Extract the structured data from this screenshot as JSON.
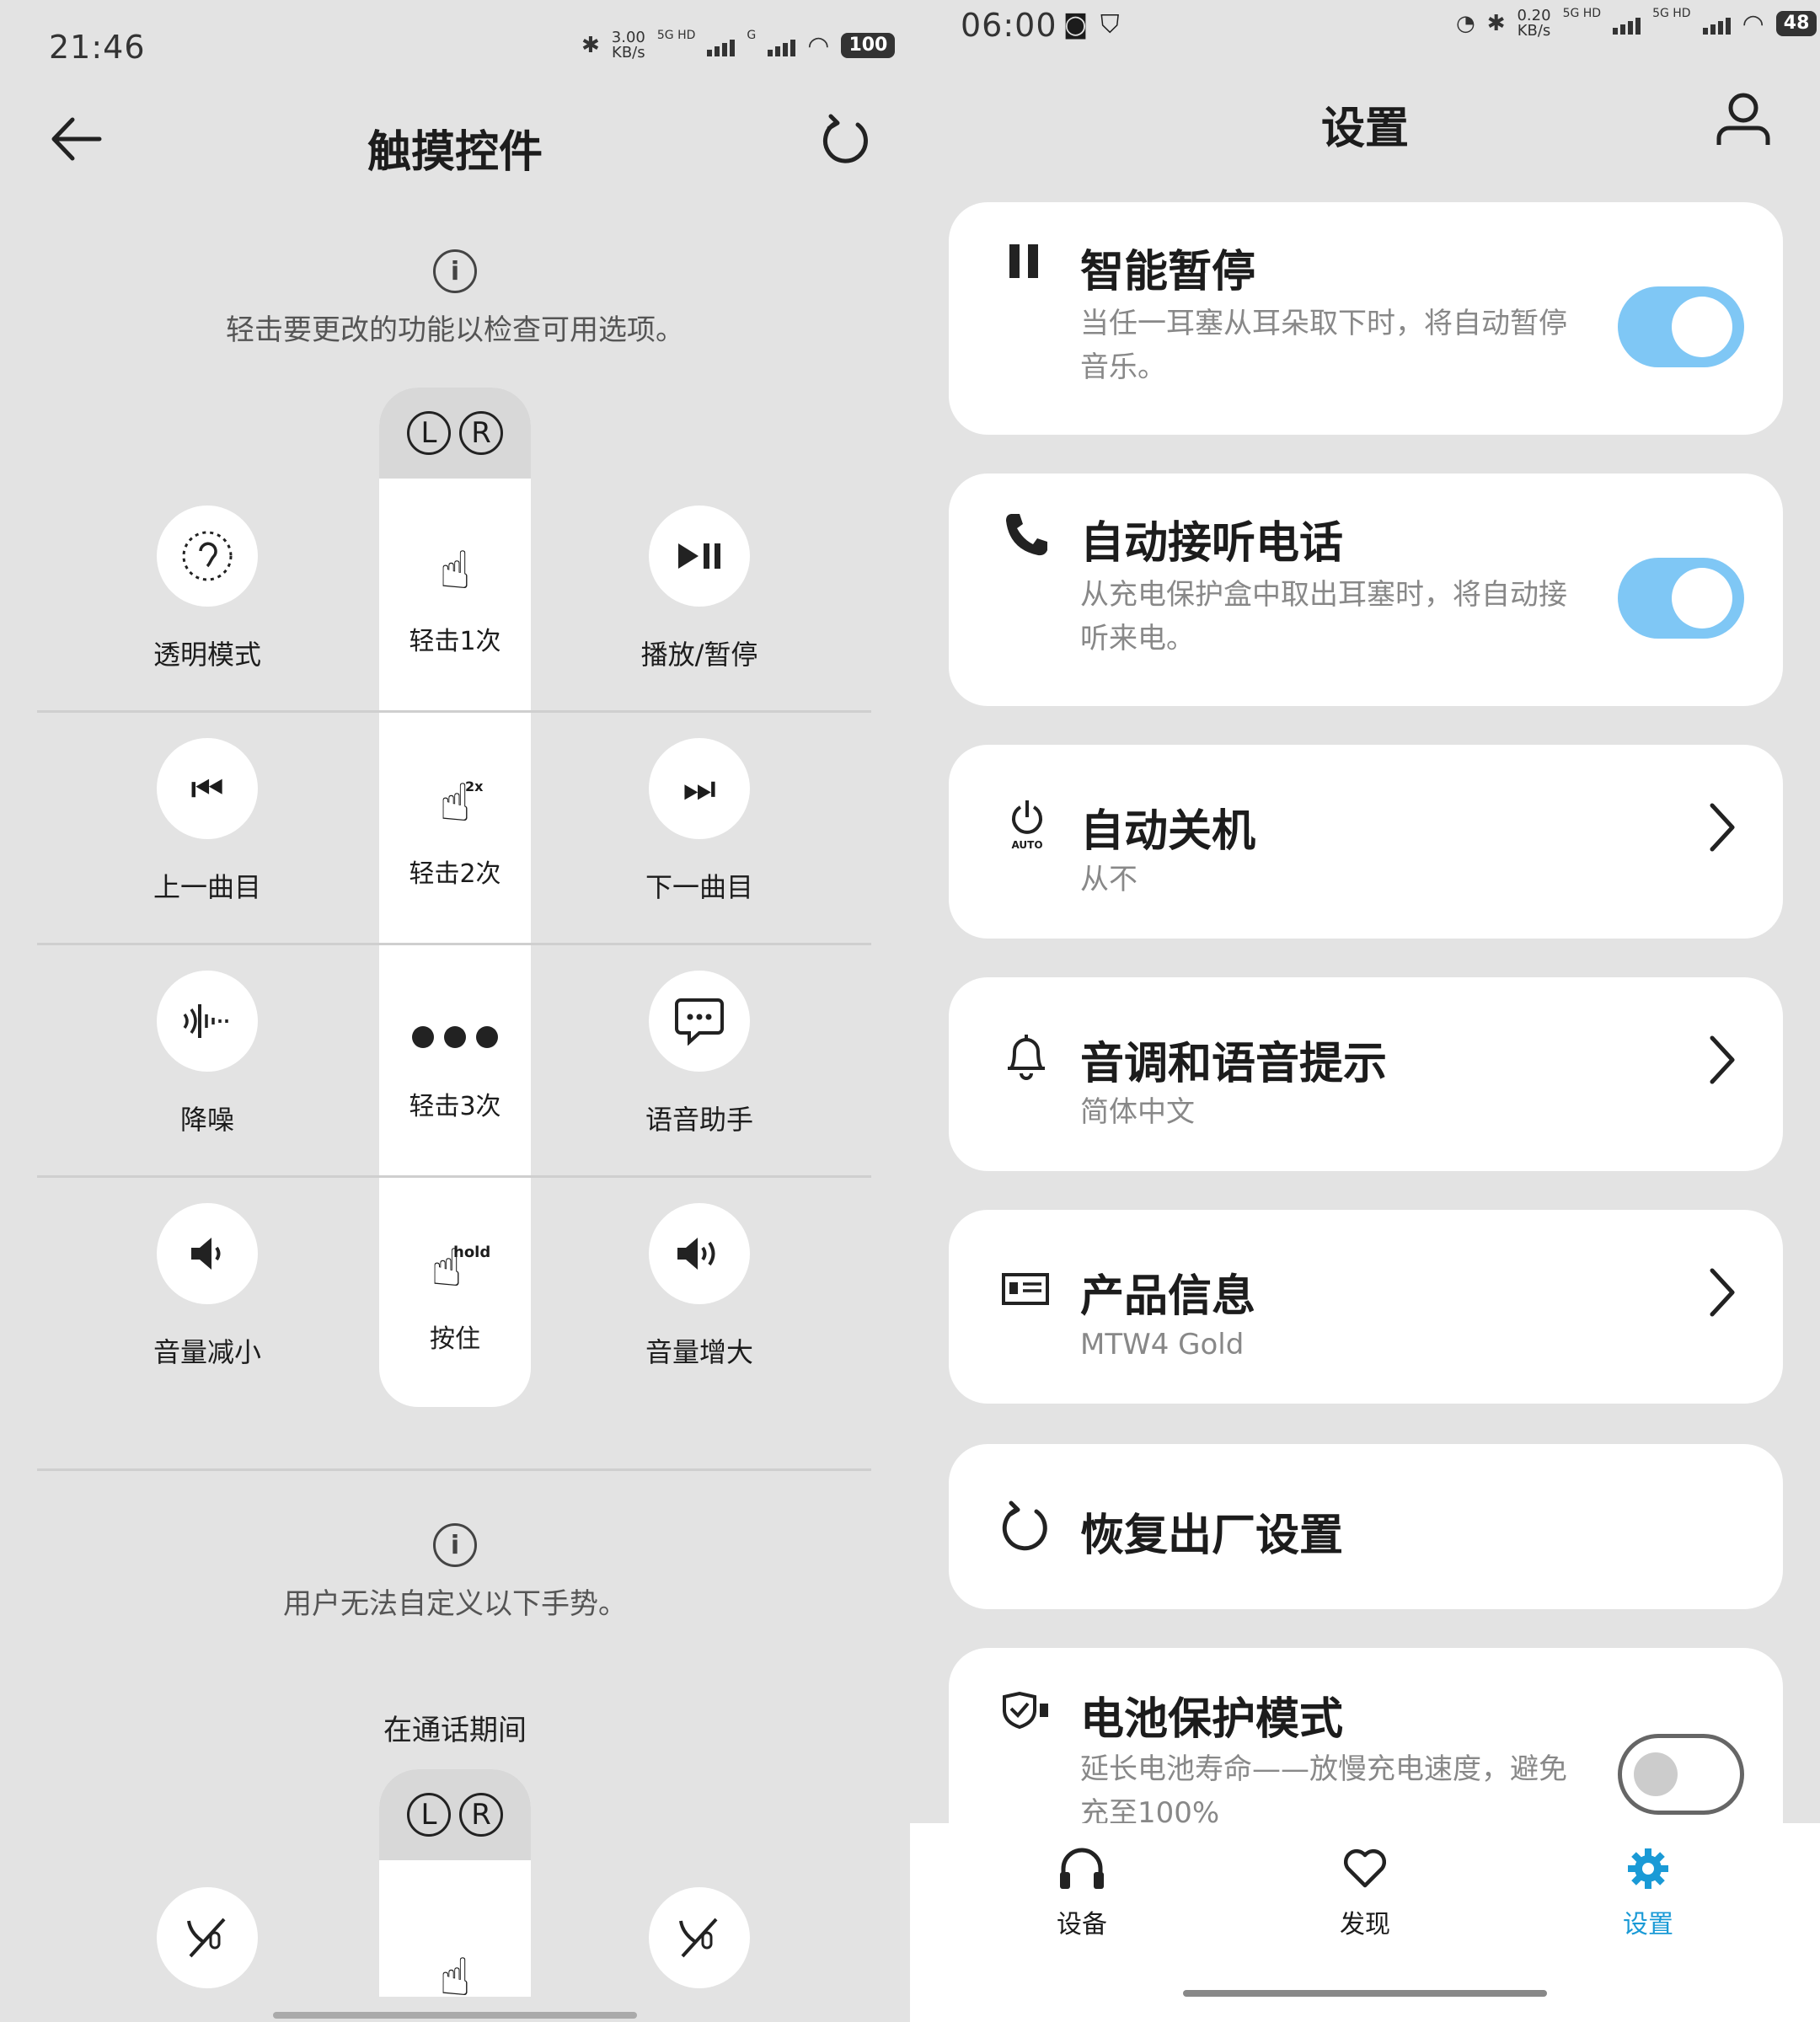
{
  "left": {
    "status": {
      "time": "21:46",
      "speed": "3.00",
      "speed_unit": "KB/s",
      "net1": "5G HD",
      "net2": "G",
      "battery": "100"
    },
    "header": {
      "title": "触摸控件"
    },
    "info1": "轻击要更改的功能以检查可用选项。",
    "column": {
      "left": "L",
      "right": "R",
      "gestures": [
        "轻击1次",
        "2x",
        "轻击2次",
        "轻击3次",
        "hold",
        "按住"
      ]
    },
    "left_actions": [
      "透明模式",
      "上一曲目",
      "降噪",
      "音量减小"
    ],
    "right_actions": [
      "播放/暂停",
      "下一曲目",
      "语音助手",
      "音量增大"
    ],
    "info2": "用户无法自定义以下手势。",
    "call_section": "在通话期间"
  },
  "right": {
    "status": {
      "time": "06:00",
      "speed": "0.20",
      "speed_unit": "KB/s",
      "net1": "5G HD",
      "net2": "5G HD",
      "battery": "48"
    },
    "header": {
      "title": "设置"
    },
    "cards": [
      {
        "title": "智能暂停",
        "sub1": "当任一耳塞从耳朵取下时，将自动暂停",
        "sub2": "音乐。",
        "toggle": true
      },
      {
        "title": "自动接听电话",
        "sub1": "从充电保护盒中取出耳塞时，将自动接",
        "sub2": "听来电。",
        "toggle": true
      },
      {
        "title": "自动关机",
        "sub1": "从不",
        "icon_text": "AUTO"
      },
      {
        "title": "音调和语音提示",
        "sub1": "简体中文"
      },
      {
        "title": "产品信息",
        "sub1": "MTW4 Gold"
      },
      {
        "title": "恢复出厂设置"
      },
      {
        "title": "电池保护模式",
        "sub1": "延长电池寿命——放慢充电速度，避免",
        "sub2": "充至100%",
        "toggle": false
      }
    ],
    "nav": {
      "devices": "设备",
      "discover": "发现",
      "settings": "设置"
    },
    "colors": {
      "accent": "#1a9ad6",
      "toggle_on": "#7fc7f5"
    }
  }
}
